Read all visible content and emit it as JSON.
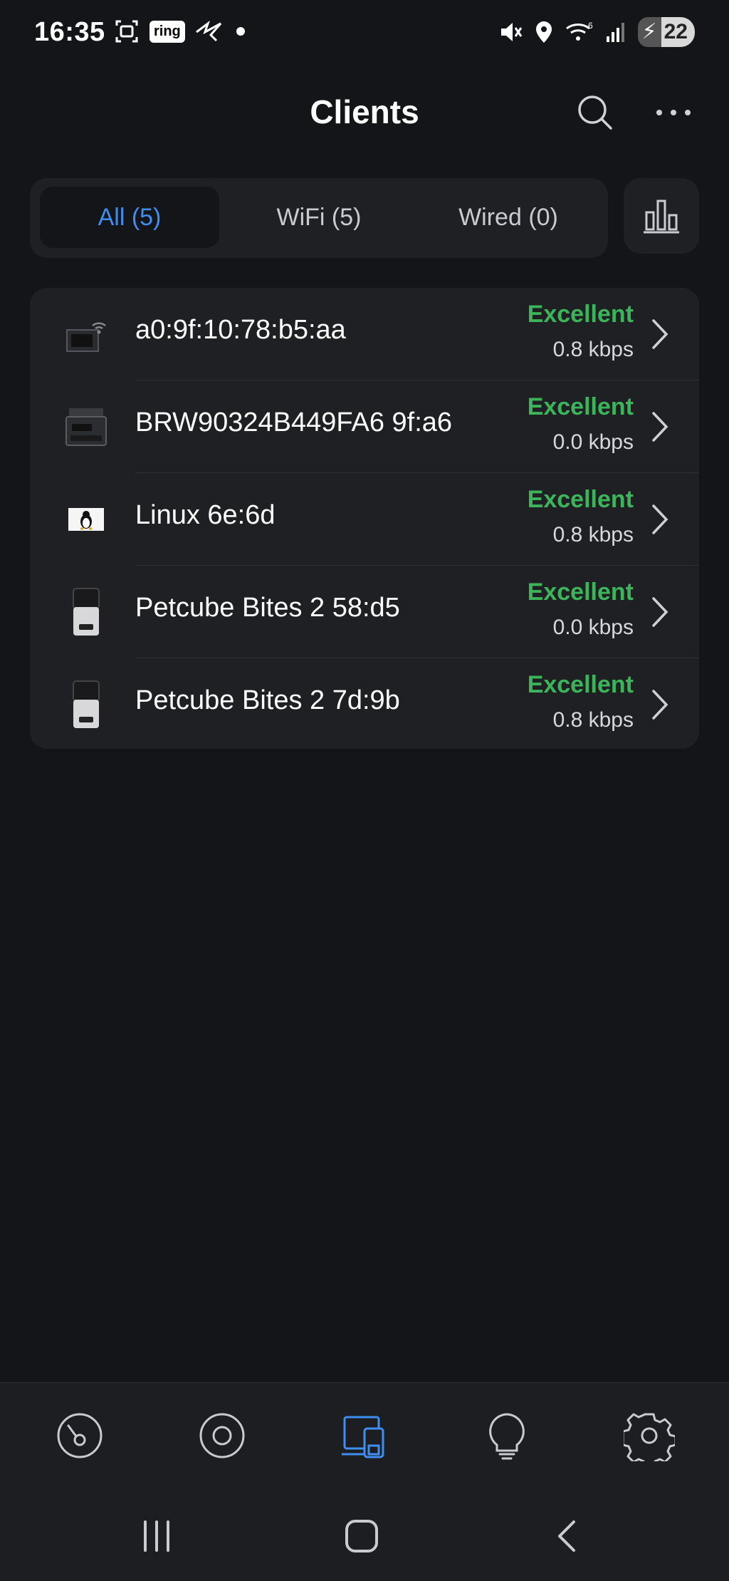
{
  "status_bar": {
    "time": "16:35",
    "ring_label": "ring",
    "battery": "22",
    "icons": [
      "screenshot-icon",
      "ring-icon",
      "bird-icon",
      "dot-icon",
      "mute-icon",
      "location-icon",
      "wifi-icon",
      "signal-icon",
      "battery-icon"
    ]
  },
  "header": {
    "title": "Clients",
    "icons": [
      "search-icon",
      "more-icon"
    ]
  },
  "filters": {
    "tabs": [
      {
        "label": "All (5)",
        "active": true
      },
      {
        "label": "WiFi (5)",
        "active": false
      },
      {
        "label": "Wired (0)",
        "active": false
      }
    ],
    "stats_icon": "bar-chart-icon"
  },
  "clients": [
    {
      "name": "a0:9f:10:78:b5:aa",
      "quality": "Excellent",
      "rate": "0.8 kbps",
      "icon": "wireless-device-icon"
    },
    {
      "name": "BRW90324B449FA6 9f:a6",
      "quality": "Excellent",
      "rate": "0.0 kbps",
      "icon": "printer-icon"
    },
    {
      "name": "Linux 6e:6d",
      "quality": "Excellent",
      "rate": "0.8 kbps",
      "icon": "linux-icon"
    },
    {
      "name": "Petcube Bites 2 58:d5",
      "quality": "Excellent",
      "rate": "0.0 kbps",
      "icon": "petcube-icon"
    },
    {
      "name": "Petcube Bites 2 7d:9b",
      "quality": "Excellent",
      "rate": "0.8 kbps",
      "icon": "petcube-icon"
    }
  ],
  "bottom_nav": {
    "items": [
      {
        "icon": "dashboard-icon",
        "active": false
      },
      {
        "icon": "devices-icon",
        "active": false
      },
      {
        "icon": "clients-icon",
        "active": true
      },
      {
        "icon": "insights-icon",
        "active": false
      },
      {
        "icon": "settings-icon",
        "active": false
      }
    ]
  },
  "colors": {
    "background": "#141518",
    "card": "#1f2024",
    "accent": "#3f8ff2",
    "excellent": "#3cb55a"
  }
}
